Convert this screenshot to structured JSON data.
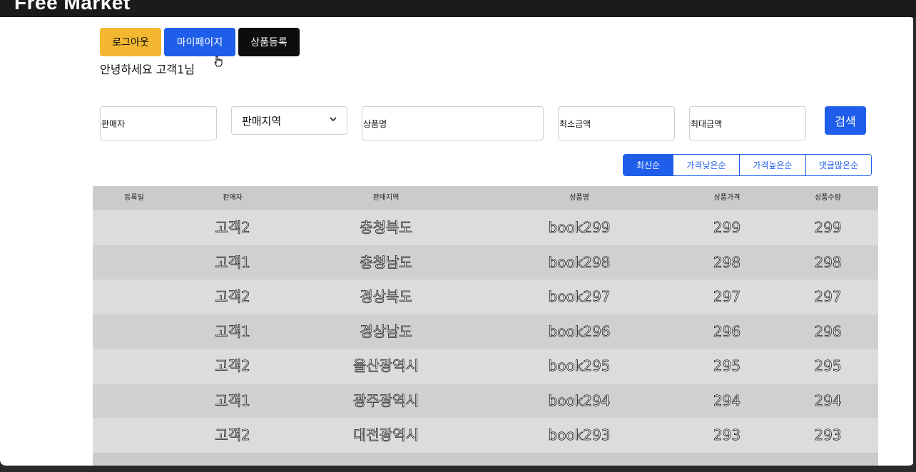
{
  "app": {
    "brand": "Free Market"
  },
  "auth": {
    "logout_label": "로그아웃",
    "mypage_label": "마이페이지",
    "register_label": "상품등록",
    "greeting": "안녕하세요 고객1님"
  },
  "search": {
    "seller_placeholder": "판매자",
    "region_value": "판매지역",
    "product_placeholder": "상품명",
    "min_price_placeholder": "최소금액",
    "max_price_placeholder": "최대금액",
    "search_label": "검색"
  },
  "sort": {
    "options": [
      "최신순",
      "가격낮은순",
      "가격높은순",
      "댓글많은순"
    ],
    "active": "최신순"
  },
  "table": {
    "headers": [
      "등록일",
      "판매자",
      "판매지역",
      "상품명",
      "상품가격",
      "상품수량"
    ],
    "rows": [
      [
        "",
        "고객2",
        "충청북도",
        "book299",
        "299",
        "299"
      ],
      [
        "",
        "고객1",
        "충청남도",
        "book298",
        "298",
        "298"
      ],
      [
        "",
        "고객2",
        "경상북도",
        "book297",
        "297",
        "297"
      ],
      [
        "",
        "고객1",
        "경상남도",
        "book296",
        "296",
        "296"
      ],
      [
        "",
        "고객2",
        "울산광역시",
        "book295",
        "295",
        "295"
      ],
      [
        "",
        "고객1",
        "광주광역시",
        "book294",
        "294",
        "294"
      ],
      [
        "",
        "고객2",
        "대전광역시",
        "book293",
        "293",
        "293"
      ]
    ]
  },
  "colors": {
    "primary": "#1f5eea",
    "warning": "#f3b731",
    "dark": "#0d0d0f",
    "table_header": "#cbcbcb"
  }
}
